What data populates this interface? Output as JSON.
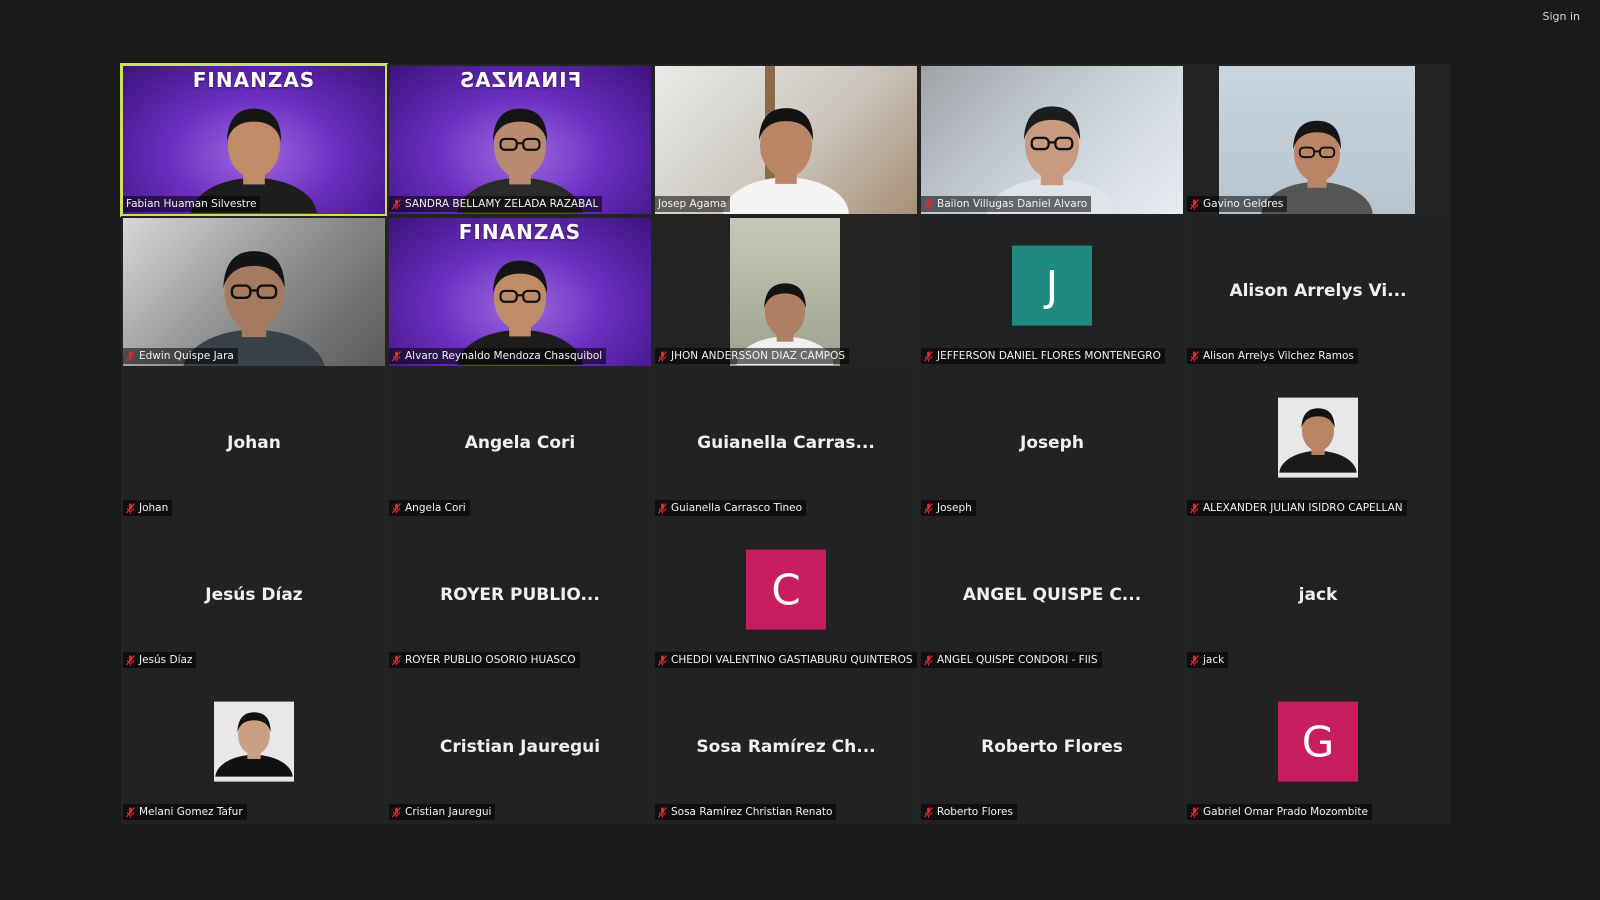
{
  "window": {
    "signin_label": "Sign in"
  },
  "colors": {
    "background": "#1a1a1a",
    "tile": "#232323",
    "active_speaker_border": "#cde05a",
    "avatar_teal": "#1f8a80",
    "avatar_magenta": "#c81d5e",
    "muted_icon": "#e02828"
  },
  "participants": [
    {
      "label": "Fabian Huaman Silvestre",
      "kind": "video-finanzas",
      "speaking": true,
      "muted": false,
      "overlay": "FINANZAS"
    },
    {
      "label": "SANDRA BELLAMY ZELADA RAZABAL",
      "kind": "video-finanzas-mirrored",
      "muted": true,
      "overlay": "FINANZAS"
    },
    {
      "label": "Josep Agama",
      "kind": "video-room",
      "muted": false
    },
    {
      "label": "Bailon Villugas Daniel Alvaro",
      "kind": "video-blue",
      "muted": true
    },
    {
      "label": "Gavino Geldres",
      "kind": "video-narrow",
      "muted": true
    },
    {
      "label": "Edwin Quispe Jara",
      "kind": "video-gray",
      "muted": true
    },
    {
      "label": "Alvaro Reynaldo Mendoza Chasquibol",
      "kind": "video-finanzas",
      "muted": true,
      "overlay": "FINANZAS"
    },
    {
      "label": "JHON ANDERSSON DIAZ CAMPOS",
      "kind": "video-narrow-room",
      "muted": true
    },
    {
      "label": "JEFFERSON DANIEL FLORES MONTENEGRO",
      "kind": "avatar",
      "letter": "J",
      "avatar_color": "#1f8a80",
      "muted": true
    },
    {
      "label": "Alison Arrelys Vilchez Ramos",
      "kind": "name",
      "display": "Alison  Arrelys  Vi...",
      "muted": true
    },
    {
      "label": "Johan",
      "kind": "name",
      "display": "Johan",
      "muted": true
    },
    {
      "label": "Angela Cori",
      "kind": "name",
      "display": "Angela Cori",
      "muted": true
    },
    {
      "label": "Guianella Carrasco Tineo",
      "kind": "name",
      "display": "Guianella  Carras...",
      "muted": true
    },
    {
      "label": "Joseph",
      "kind": "name",
      "display": "Joseph",
      "muted": true
    },
    {
      "label": "ALEXANDER JULIAN ISIDRO CAPELLAN",
      "kind": "photo",
      "muted": true
    },
    {
      "label": "Jesús Díaz",
      "kind": "name",
      "display": "Jesús Díaz",
      "muted": true
    },
    {
      "label": "ROYER PUBLIO OSORIO HUASCO",
      "kind": "name",
      "display": "ROYER  PUBLIO...",
      "muted": true
    },
    {
      "label": "CHEDDI VALENTINO GASTIABURU QUINTEROS",
      "kind": "avatar",
      "letter": "C",
      "avatar_color": "#c81d5e",
      "muted": true
    },
    {
      "label": "ANGEL QUISPE CONDORI - FIIS",
      "kind": "name",
      "display": "ANGEL  QUISPE  C...",
      "muted": true
    },
    {
      "label": "jack",
      "kind": "name",
      "display": "jack",
      "muted": true
    },
    {
      "label": "Melani Gomez Tafur",
      "kind": "photo-female",
      "muted": true
    },
    {
      "label": "Cristian Jauregui",
      "kind": "name",
      "display": "Cristian Jauregui",
      "muted": true
    },
    {
      "label": "Sosa Ramírez Christian Renato",
      "kind": "name",
      "display": "Sosa  Ramírez  Ch...",
      "muted": true
    },
    {
      "label": "Roberto Flores",
      "kind": "name",
      "display": "Roberto Flores",
      "muted": true
    },
    {
      "label": "Gabriel Omar Prado Mozombite",
      "kind": "avatar",
      "letter": "G",
      "avatar_color": "#c81d5e",
      "muted": true
    }
  ]
}
